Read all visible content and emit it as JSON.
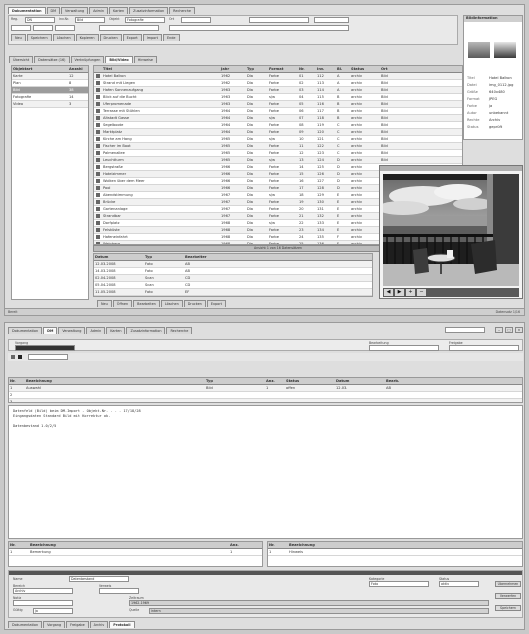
{
  "top": {
    "tabs": [
      "Dokumentation",
      "DM",
      "Verwaltung",
      "Admin",
      "Karten",
      "Zusatzinformation",
      "Recherche"
    ],
    "query_fields": [
      {
        "label": "Reg.",
        "value": "DN"
      },
      {
        "label": "Inv.Nr.",
        "value": "Bild"
      },
      {
        "label": "Objekt",
        "value": "Fotografie"
      },
      {
        "label": "Ort",
        "value": ""
      }
    ],
    "toolbar_buttons": [
      "Neu",
      "Speichern",
      "Löschen",
      "Kopieren",
      "Drucken",
      "Export",
      "Import",
      "Ende"
    ],
    "sub_tabs": [
      "Übersicht",
      "Datensätze (16)",
      "Verknüpfungen",
      "Bild/Video",
      "Hinweise"
    ],
    "left_list": {
      "headers": [
        "Objektart",
        "Anzahl"
      ],
      "rows": [
        {
          "label": "Karte",
          "count": "12"
        },
        {
          "label": "Plan",
          "count": "8"
        },
        {
          "label": "Bild",
          "count": "38"
        },
        {
          "label": "Fotografie",
          "count": "14"
        },
        {
          "label": "Video",
          "count": "3"
        }
      ]
    },
    "grid": {
      "headers": [
        "Titel",
        "Jahr",
        "Typ",
        "Format",
        "Nr.",
        "Inv.",
        "Bl.",
        "Status",
        "Ort"
      ],
      "rows": [
        [
          "Hotel Balkon",
          "1962",
          "Dia",
          "Farbe",
          "01",
          "112",
          "A",
          "archiv",
          "Bild"
        ],
        [
          "Strand mit Liegen",
          "1962",
          "Dia",
          "Farbe",
          "02",
          "113",
          "A",
          "archiv",
          "Bild"
        ],
        [
          "Hafen Sonnenaufgang",
          "1963",
          "Dia",
          "Farbe",
          "03",
          "114",
          "A",
          "archiv",
          "Bild"
        ],
        [
          "Blick auf die Bucht",
          "1963",
          "Dia",
          "s/w",
          "04",
          "115",
          "B",
          "archiv",
          "Bild"
        ],
        [
          "Uferpromenade",
          "1963",
          "Dia",
          "Farbe",
          "05",
          "116",
          "B",
          "archiv",
          "Bild"
        ],
        [
          "Terrasse mit Stühlen",
          "1964",
          "Dia",
          "Farbe",
          "06",
          "117",
          "B",
          "archiv",
          "Bild"
        ],
        [
          "Altstadt Gasse",
          "1964",
          "Dia",
          "s/w",
          "07",
          "118",
          "B",
          "archiv",
          "Bild"
        ],
        [
          "Segelboote",
          "1964",
          "Dia",
          "Farbe",
          "08",
          "119",
          "C",
          "archiv",
          "Bild"
        ],
        [
          "Marktplatz",
          "1964",
          "Dia",
          "Farbe",
          "09",
          "120",
          "C",
          "archiv",
          "Bild"
        ],
        [
          "Kirche am Hang",
          "1965",
          "Dia",
          "s/w",
          "10",
          "121",
          "C",
          "archiv",
          "Bild"
        ],
        [
          "Fischer im Boot",
          "1965",
          "Dia",
          "Farbe",
          "11",
          "122",
          "C",
          "archiv",
          "Bild"
        ],
        [
          "Palmenallee",
          "1965",
          "Dia",
          "Farbe",
          "12",
          "123",
          "C",
          "archiv",
          "Bild"
        ],
        [
          "Leuchtturm",
          "1965",
          "Dia",
          "s/w",
          "13",
          "124",
          "D",
          "archiv",
          "Bild"
        ],
        [
          "Bergstraße",
          "1966",
          "Dia",
          "Farbe",
          "14",
          "125",
          "D",
          "archiv",
          "Bild"
        ],
        [
          "Hotelzimmer",
          "1966",
          "Dia",
          "Farbe",
          "15",
          "126",
          "D",
          "archiv",
          "Bild"
        ],
        [
          "Wolken über dem Meer",
          "1966",
          "Dia",
          "Farbe",
          "16",
          "127",
          "D",
          "archiv",
          "Bild"
        ],
        [
          "Pool",
          "1966",
          "Dia",
          "Farbe",
          "17",
          "128",
          "D",
          "archiv",
          "Bild"
        ],
        [
          "Abendstimmung",
          "1967",
          "Dia",
          "s/w",
          "18",
          "129",
          "E",
          "archiv",
          "Bild"
        ],
        [
          "Brücke",
          "1967",
          "Dia",
          "Farbe",
          "19",
          "130",
          "E",
          "archiv",
          "Bild"
        ],
        [
          "Gartenanlage",
          "1967",
          "Dia",
          "Farbe",
          "20",
          "131",
          "E",
          "archiv",
          "Bild"
        ],
        [
          "Strandbar",
          "1967",
          "Dia",
          "Farbe",
          "21",
          "132",
          "E",
          "archiv",
          "Bild"
        ],
        [
          "Dorfplatz",
          "1968",
          "Dia",
          "s/w",
          "22",
          "133",
          "E",
          "archiv",
          "Bild"
        ],
        [
          "Felsküste",
          "1968",
          "Dia",
          "Farbe",
          "23",
          "134",
          "E",
          "archiv",
          "Bild"
        ],
        [
          "Hafeneinfahrt",
          "1968",
          "Dia",
          "Farbe",
          "24",
          "135",
          "F",
          "archiv",
          "Bild"
        ],
        [
          "Weinberg",
          "1968",
          "Dia",
          "Farbe",
          "25",
          "136",
          "F",
          "archiv",
          "Bild"
        ],
        [
          "Kloster",
          "1969",
          "Dia",
          "s/w",
          "26",
          "137",
          "F",
          "archiv",
          "Bild"
        ],
        [
          "Fährschiff",
          "1969",
          "Dia",
          "Farbe",
          "27",
          "138",
          "F",
          "archiv",
          "Bild"
        ]
      ]
    },
    "grid_footer": "Ansicht 1 von 16 Datensätzen",
    "bottom_list": {
      "headers": [
        "Datum",
        "Typ",
        "Bearbeiter"
      ],
      "rows": [
        [
          "12.03.2008",
          "Foto",
          "AB"
        ],
        [
          "14.03.2008",
          "Foto",
          "AB"
        ],
        [
          "02.04.2008",
          "Scan",
          "CD"
        ],
        [
          "05.04.2008",
          "Scan",
          "CD"
        ],
        [
          "11.05.2008",
          "Foto",
          "EF"
        ],
        [
          "19.06.2008",
          "Foto",
          "EF"
        ]
      ]
    },
    "right_panel": {
      "title": "Bildinformation",
      "rows": [
        {
          "label": "Titel",
          "value": "Hotel Balkon"
        },
        {
          "label": "Datei",
          "value": "img_0112.jpg"
        },
        {
          "label": "Größe",
          "value": "640x480"
        },
        {
          "label": "Format",
          "value": "JPEG"
        },
        {
          "label": "Farbe",
          "value": "ja"
        },
        {
          "label": "Autor",
          "value": "unbekannt"
        },
        {
          "label": "Rechte",
          "value": "Archiv"
        },
        {
          "label": "Status",
          "value": "geprüft"
        }
      ]
    },
    "viewer_toolbar": [
      "◀",
      "▶",
      "+",
      "−"
    ],
    "bottom_buttons": [
      "Neu",
      "Öffnen",
      "Bearbeiten",
      "Löschen",
      "Drucken",
      "Export"
    ],
    "status_left": "Bereit",
    "status_right": "Datensatz 1/16"
  },
  "bottom": {
    "tabs": [
      "Dokumentation",
      "DM",
      "Verwaltung",
      "Admin",
      "Karten",
      "Zusatzinformation",
      "Recherche"
    ],
    "header_fields": [
      "Vorgang",
      "Bearbeitung",
      "Freigabe"
    ],
    "list_headers": [
      "Nr.",
      "Bezeichnung",
      "Typ",
      "Anz.",
      "Status",
      "Datum",
      "Bearb."
    ],
    "list_rows": [
      [
        "1",
        "Auswahl",
        "Bild",
        "1",
        "offen",
        "12.03.",
        "AB"
      ],
      [
        "2",
        "",
        "",
        "",
        "",
        "",
        ""
      ],
      [
        "3",
        "",
        "",
        "",
        "",
        "",
        ""
      ]
    ],
    "editor_lines": [
      "Datenfeld (Bild) beim DM-Import - Objekt-Nr. . . . 17/18/28",
      "Eingangsdaten Standard Bild mit Korrektur ok.",
      "",
      "Datenbestand 1.0/2/5"
    ],
    "footer_left_headers": [
      "Nr.",
      "Bezeichnung",
      "Anz."
    ],
    "footer_left_row": [
      "1",
      "Bemerkung",
      "1"
    ],
    "footer_right_headers": [
      "Nr.",
      "Bezeichnung"
    ],
    "footer_right_row": [
      "1",
      "Hinweis"
    ],
    "form_labels": [
      "Name",
      "Bereich",
      "Verweis",
      "Kategorie",
      "Notiz",
      "Status",
      "Zeitraum",
      "Gültig",
      "Quelle"
    ],
    "form_values": [
      "Datenbestand",
      "Archiv",
      "",
      "Foto",
      "",
      "aktiv",
      "1962-1969",
      "ja",
      "intern"
    ],
    "action_buttons": [
      "Übernehmen",
      "Verwerfen",
      "Speichern"
    ],
    "status_tabs": [
      "Dokumentation",
      "Vorgang",
      "Freigabe",
      "Archiv",
      "Protokoll"
    ]
  }
}
